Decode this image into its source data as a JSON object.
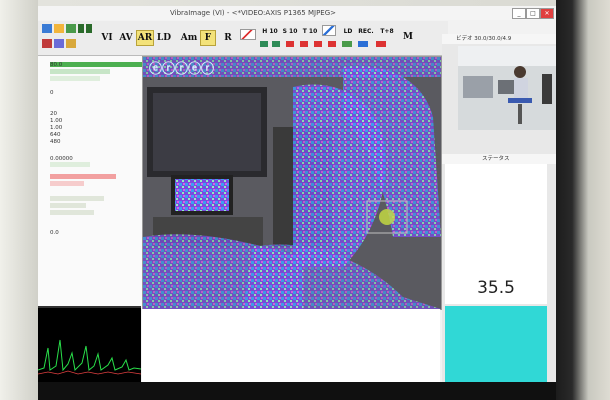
{
  "window": {
    "title": "VibraImage (VI)  - <*VIDEO:AXIS P1365 MJPEG>"
  },
  "toolbar": {
    "buttons": [
      "VI",
      "AV",
      "AR",
      "LD",
      "Am",
      "F",
      "R"
    ],
    "selected": [
      "AR",
      "F"
    ],
    "small_buttons": [
      "H 10",
      "S 10",
      "T 10",
      "LD",
      "REC.",
      "T+8",
      "M"
    ]
  },
  "left_panel": {
    "values": [
      "80.0",
      "0",
      "20",
      "1.00",
      "1.00",
      "640",
      "480",
      "0.00000",
      "0.0"
    ]
  },
  "right_panel": {
    "video_header": "ビデオ 30.0/30.0/4.9",
    "status_header": "ステータス",
    "status_value": "35.5"
  },
  "colors": {
    "status_box": "#30d8d6",
    "toolbar_selected": "#f3e27a",
    "green_bar": "#4caf50",
    "red_bar": "#f2a0a0"
  }
}
